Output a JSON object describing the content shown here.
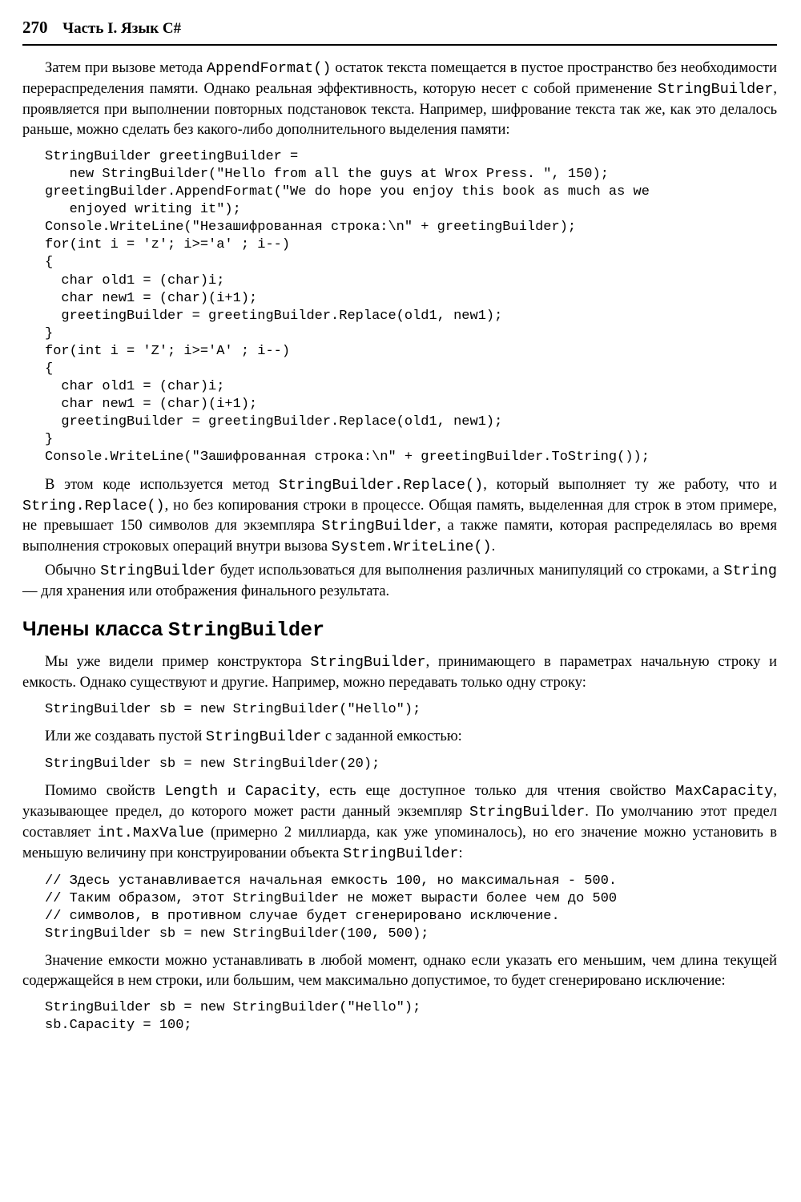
{
  "header": {
    "pageNumber": "270",
    "sectionTitle": "Часть I. Язык C#"
  },
  "paragraphs": {
    "p1_a": "Затем при вызове метода ",
    "p1_code1": "AppendFormat()",
    "p1_b": " остаток текста помещается в пустое пространство без необходимости перераспределения памяти. Однако реальная эффективность, которую несет с собой применение ",
    "p1_code2": "StringBuilder",
    "p1_c": ", проявляется при выполнении повторных подстановок текста. Например, шифрование текста так же, как это делалось раньше, можно сделать без какого-либо дополнительного выделения памяти:",
    "p2_a": "В этом коде используется метод ",
    "p2_code1": "StringBuilder.Replace()",
    "p2_b": ", который выполняет ту же работу, что и ",
    "p2_code2": "String.Replace()",
    "p2_c": ", но без копирования строки в процессе. Общая память, выделенная для строк в этом примере, не превышает 150 символов для экземпляра ",
    "p2_code3": "StringBuilder",
    "p2_d": ", а также памяти, которая распределялась во время выполнения строковых операций внутри вызова ",
    "p2_code4": "System.WriteLine()",
    "p2_e": ".",
    "p3_a": "Обычно ",
    "p3_code1": "StringBuilder",
    "p3_b": " будет использоваться для выполнения различных манипуляций со строками, а ",
    "p3_code2": "String",
    "p3_c": " — для хранения или отображения финального результата.",
    "p4_a": "Мы уже видели пример конструктора ",
    "p4_code1": "StringBuilder",
    "p4_b": ", принимающего в параметрах начальную строку и емкость. Однако существуют и другие. Например, можно передавать только одну строку:",
    "p5_a": "Или же создавать пустой ",
    "p5_code1": "StringBuilder",
    "p5_b": " с заданной емкостью:",
    "p6_a": "Помимо свойств ",
    "p6_code1": "Length",
    "p6_b": " и ",
    "p6_code2": "Capacity",
    "p6_c": ", есть еще доступное только для чтения свойство ",
    "p6_code3": "MaxCapacity",
    "p6_d": ", указывающее предел, до которого может расти данный экземпляр ",
    "p6_code4": "StringBuilder",
    "p6_e": ". По умолчанию этот предел составляет ",
    "p6_code5": "int.MaxValue",
    "p6_f": " (примерно 2 миллиарда, как уже упоминалось), но его значение можно установить в меньшую величину при конструировании объекта ",
    "p6_code6": "StringBuilder",
    "p6_g": ":",
    "p7": "Значение емкости можно устанавливать в любой момент, однако если указать его меньшим, чем длина текущей содержащейся в нем строки, или большим, чем максимально допустимое, то будет сгенерировано исключение:"
  },
  "codeBlocks": {
    "code1": "StringBuilder greetingBuilder =\n   new StringBuilder(\"Hello from all the guys at Wrox Press. \", 150);\ngreetingBuilder.AppendFormat(\"We do hope you enjoy this book as much as we\n   enjoyed writing it\");\nConsole.WriteLine(\"Незашифрованная строка:\\n\" + greetingBuilder);\nfor(int i = 'z'; i>='a' ; i--)\n{\n  char old1 = (char)i;\n  char new1 = (char)(i+1);\n  greetingBuilder = greetingBuilder.Replace(old1, new1);\n}\nfor(int i = 'Z'; i>='A' ; i--)\n{\n  char old1 = (char)i;\n  char new1 = (char)(i+1);\n  greetingBuilder = greetingBuilder.Replace(old1, new1);\n}\nConsole.WriteLine(\"Зашифрованная строка:\\n\" + greetingBuilder.ToString());",
    "code2": "StringBuilder sb = new StringBuilder(\"Hello\");",
    "code3": "StringBuilder sb = new StringBuilder(20);",
    "code4": "// Здесь устанавливается начальная емкость 100, но максимальная - 500.\n// Таким образом, этот StringBuilder не может вырасти более чем до 500\n// символов, в противном случае будет сгенерировано исключение.\nStringBuilder sb = new StringBuilder(100, 500);",
    "code5": "StringBuilder sb = new StringBuilder(\"Hello\");\nsb.Capacity = 100;"
  },
  "heading2": {
    "text": "Члены класса ",
    "code": "StringBuilder"
  }
}
